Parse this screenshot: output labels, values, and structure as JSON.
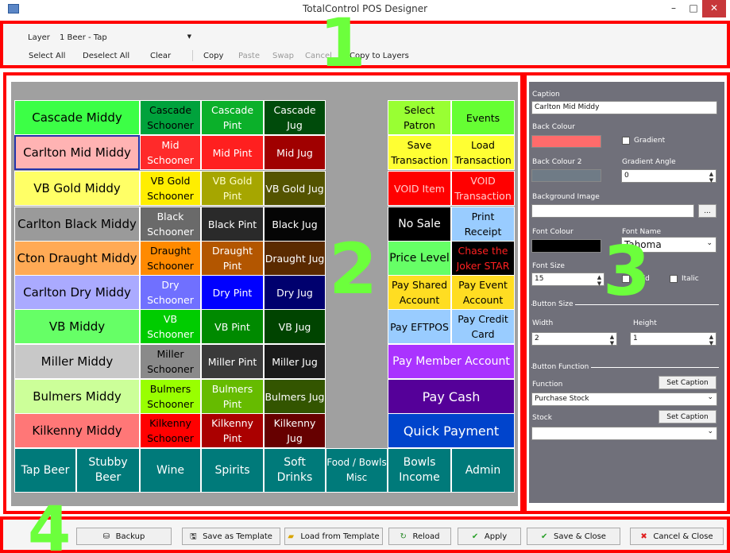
{
  "window": {
    "title": "TotalControl POS Designer",
    "minimize": "–",
    "maximize": "□",
    "close": "✕"
  },
  "toolbar": {
    "layer_label": "Layer",
    "layer_value": "1 Beer - Tap",
    "select_all": "Select All",
    "deselect_all": "Deselect All",
    "clear": "Clear",
    "copy": "Copy",
    "paste": "Paste",
    "swap": "Swap",
    "cancel": "Cancel",
    "copy_to_layers": "Copy to Layers"
  },
  "annotations": [
    "1",
    "2",
    "3",
    "4"
  ],
  "grid": {
    "left_column": [
      "Cascade Middy",
      "Carlton Mid Middy",
      "VB Gold Middy",
      "Carlton Black Middy",
      "Cton Draught Middy",
      "Carlton Dry Middy",
      "VB Middy",
      "Miller Middy",
      "Bulmers Middy",
      "Kilkenny Middy"
    ],
    "schooner_column": [
      "Cascade Schooner",
      "Mid Schooner",
      "VB Gold Schooner",
      "Black Schooner",
      "Draught Schooner",
      "Dry Schooner",
      "VB Schooner",
      "Miller Schooner",
      "Bulmers Schooner",
      "Kilkenny Schooner"
    ],
    "pint_column": [
      "Cascade Pint",
      "Mid Pint",
      "VB Gold Pint",
      "Black Pint",
      "Draught Pint",
      "Dry Pint",
      "VB Pint",
      "Miller Pint",
      "Bulmers Pint",
      "Kilkenny Pint"
    ],
    "jug_column": [
      "Cascade Jug",
      "Mid Jug",
      "VB Gold Jug",
      "Black Jug",
      "Draught Jug",
      "Dry Jug",
      "VB Jug",
      "Miller Jug",
      "Bulmers Jug",
      "Kilkenny Jug"
    ],
    "right_pairs": [
      [
        "Select Patron",
        "Events"
      ],
      [
        "Save Transaction",
        "Load Transaction"
      ],
      [
        "VOID Item",
        "VOID Transaction"
      ],
      [
        "No Sale",
        "Print Receipt"
      ],
      [
        "Price Level",
        "Chase the Joker STAR"
      ],
      [
        "Pay Shared Account",
        "Pay Event Account"
      ],
      [
        "Pay EFTPOS",
        "Pay Credit Card"
      ]
    ],
    "right_wide": [
      "Pay Member Account",
      "Pay Cash",
      "Quick Payment"
    ],
    "bottom_tabs": [
      "Tap Beer",
      "Stubby Beer",
      "Wine",
      "Spirits",
      "Soft Drinks",
      "Food / Bowls Misc",
      "Bowls Income",
      "Admin"
    ]
  },
  "props": {
    "caption_label": "Caption",
    "caption_value": "Carlton Mid Middy",
    "back_colour_label": "Back Colour",
    "back_colour": "#ff6b6b",
    "gradient_label": "Gradient",
    "back_colour2_label": "Back Colour 2",
    "gradient_angle_label": "Gradient Angle",
    "gradient_angle_value": "0",
    "background_image_label": "Background Image",
    "browse": "...",
    "font_colour_label": "Font Colour",
    "font_colour": "#000000",
    "font_name_label": "Font Name",
    "font_name_value": "Tahoma",
    "font_size_label": "Font Size",
    "font_size_value": "15",
    "bold_label": "Bold",
    "italic_label": "Italic",
    "button_size_label": "Button Size",
    "width_label": "Width",
    "width_value": "2",
    "height_label": "Height",
    "height_value": "1",
    "button_function_label": "Button Function",
    "function_label": "Function",
    "function_value": "Purchase Stock",
    "set_caption": "Set Caption",
    "stock_label": "Stock",
    "stock_value": ""
  },
  "bottom": {
    "backup": "Backup",
    "save_template": "Save as Template",
    "load_template": "Load from Template",
    "reload": "Reload",
    "apply": "Apply",
    "save_close": "Save & Close",
    "cancel_close": "Cancel & Close"
  },
  "colors": {
    "accent_red": "#ff0000",
    "annotation_green": "#6cff3c"
  }
}
